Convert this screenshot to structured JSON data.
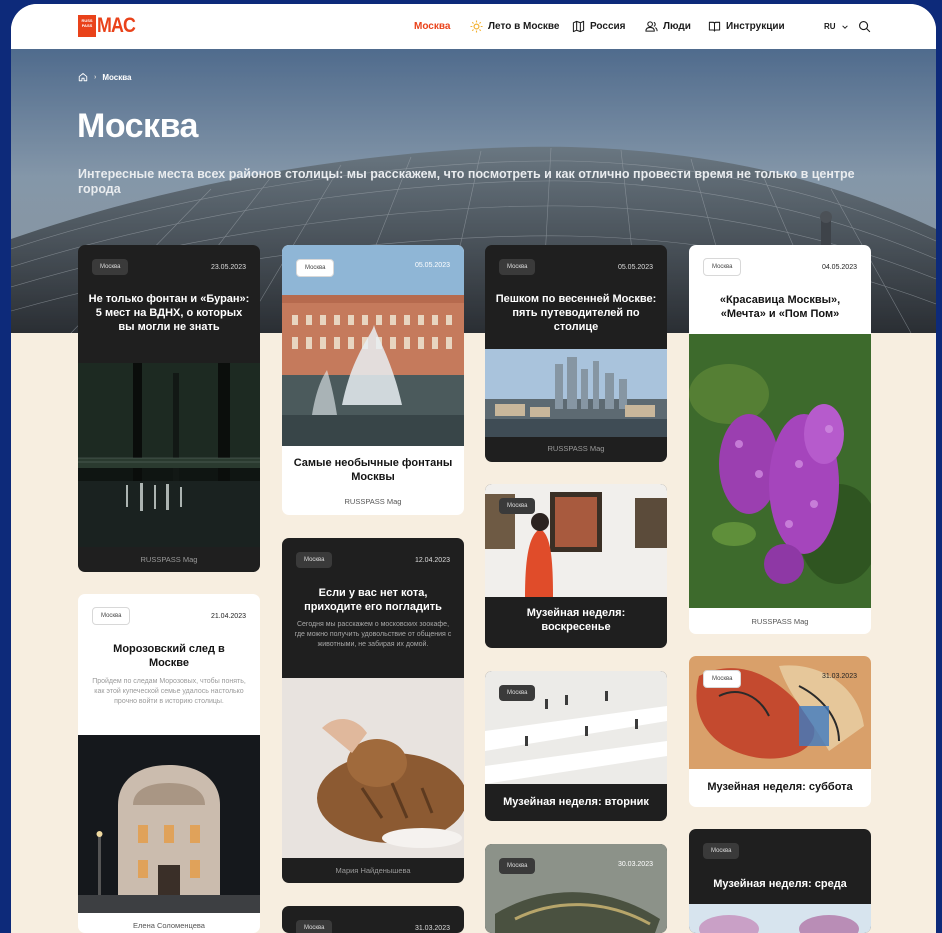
{
  "header": {
    "logo_small": "RUSS PASS",
    "logo_text": "MAC",
    "nav": [
      {
        "label": "Москва",
        "active": true,
        "icon": ""
      },
      {
        "label": "Лето в Москве",
        "active": false,
        "icon": "sun-icon"
      },
      {
        "label": "Россия",
        "active": false,
        "icon": "map-icon"
      },
      {
        "label": "Люди",
        "active": false,
        "icon": "people-icon"
      },
      {
        "label": "Инструкции",
        "active": false,
        "icon": "book-icon"
      }
    ],
    "lang": "RU",
    "accent": "#e9421a"
  },
  "breadcrumb": {
    "current": "Москва"
  },
  "page": {
    "title": "Москва",
    "subtitle": "Интересные места всех районов столицы: мы расскажем, что посмотреть и как отлично провести время не только в центре города"
  },
  "cards": [
    {
      "tag": "Москва",
      "date": "23.05.2023",
      "title": "Не только фонтан и «Буран»: 5 мест на ВДНХ, о которых вы могли не знать",
      "source": "RUSSPASS Mag"
    },
    {
      "tag": "Москва",
      "date": "05.05.2023",
      "title": "Самые необычные фонтаны Москвы",
      "source": "RUSSPASS Mag"
    },
    {
      "tag": "Москва",
      "date": "05.05.2023",
      "title": "Пешком по весенней Москве: пять путеводителей по столице",
      "source": "RUSSPASS Mag"
    },
    {
      "tag": "Москва",
      "date": "04.05.2023",
      "title": "«Красавица Москвы», «Мечта» и «Пом Пом»",
      "source": "RUSSPASS Mag"
    },
    {
      "tag": "Москва",
      "date": "12.04.2023",
      "title": "Если у вас нет кота, приходите его погладить",
      "desc": "Сегодня мы расскажем о московских зоокафе, где можно получить удовольствие от общения с животными, не забирая их домой.",
      "source": "Мария Найденышева"
    },
    {
      "tag": "Москва",
      "date": "",
      "title": "Музейная неделя: воскресенье",
      "source": ""
    },
    {
      "tag": "Москва",
      "date": "21.04.2023",
      "title": "Морозовский след в Москве",
      "desc": "Пройдем по следам Морозовых, чтобы понять, как этой купеческой семье удалось настолько прочно войти в историю столицы.",
      "source": "Елена Соломенцева"
    },
    {
      "tag": "Москва",
      "date": "",
      "title": "Музейная неделя: вторник",
      "source": ""
    },
    {
      "tag": "Москва",
      "date": "31.03.2023",
      "title": "Музейная неделя: суббота",
      "source": ""
    },
    {
      "tag": "Москва",
      "date": "",
      "title": "Музейная неделя: среда",
      "source": ""
    },
    {
      "tag": "Москва",
      "date": "30.03.2023",
      "title": "",
      "source": ""
    },
    {
      "tag": "Москва",
      "date": "31.03.2023",
      "title": "",
      "source": ""
    }
  ]
}
